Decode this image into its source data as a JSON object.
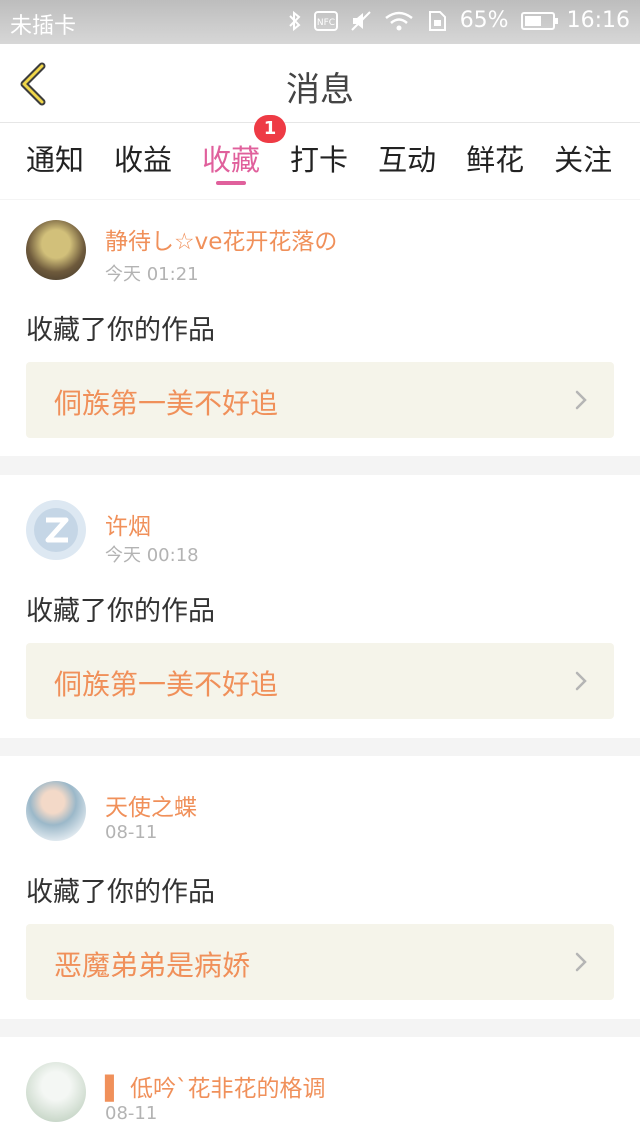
{
  "status_bar": {
    "carrier": "未插卡",
    "battery": "65%",
    "battery_level": 0.65,
    "time": "16:16",
    "icons": [
      "bluetooth-icon",
      "nfc-icon",
      "mute-icon",
      "wifi-icon",
      "sim-icon"
    ]
  },
  "header": {
    "title": "消息"
  },
  "tabs": [
    {
      "label": "通知"
    },
    {
      "label": "收益"
    },
    {
      "label": "收藏",
      "active": true,
      "badge": "1"
    },
    {
      "label": "打卡"
    },
    {
      "label": "互动"
    },
    {
      "label": "鲜花"
    },
    {
      "label": "关注"
    }
  ],
  "messages": [
    {
      "user": "静待し☆ve花开花落の",
      "time": "今天 01:21",
      "action": "收藏了你的作品",
      "work": "侗族第一美不好追"
    },
    {
      "user": "许烟",
      "time": "今天 00:18",
      "action": "收藏了你的作品",
      "work": "侗族第一美不好追"
    },
    {
      "user": "天使之蝶",
      "time": "08-11",
      "action": "收藏了你的作品",
      "work": "恶魔弟弟是病娇"
    },
    {
      "user": "▌ 低吟ˋ花非花的格调",
      "time": "08-11"
    }
  ],
  "colors": {
    "accent": "#e0609c",
    "name": "#f0905a",
    "badge": "#ee3b45",
    "work_bg": "#f5f4ea"
  }
}
